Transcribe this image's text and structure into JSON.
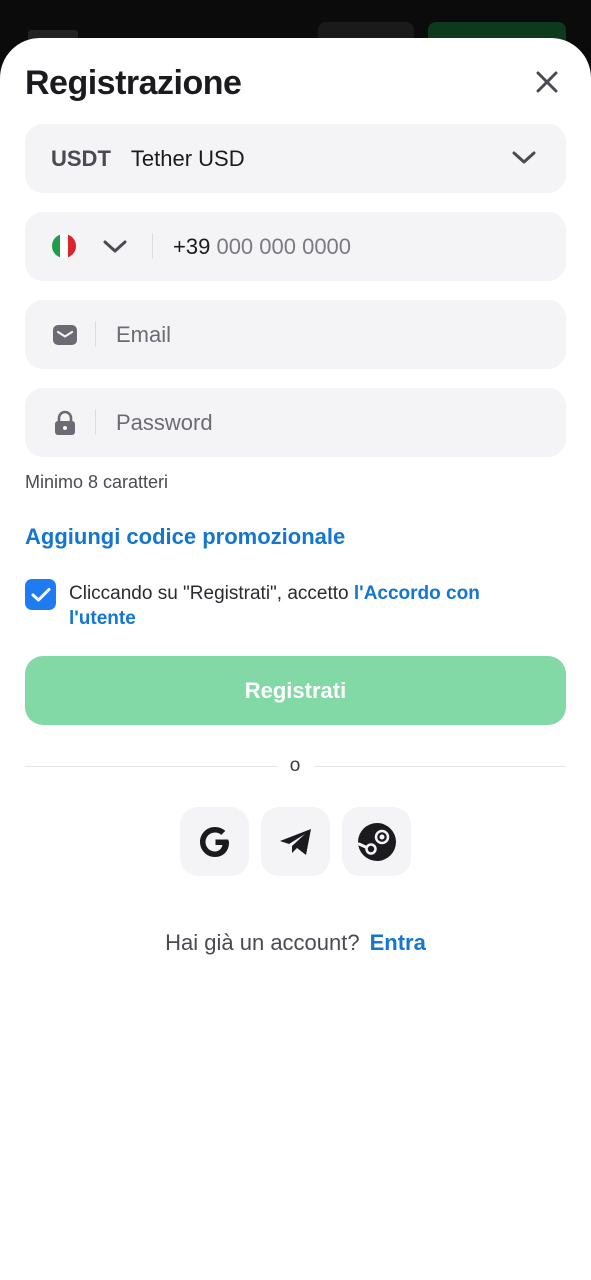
{
  "colors": {
    "accent": "#1576d2",
    "checkbox": "#1e7cf0",
    "submit_disabled": "#83d9a5",
    "field_bg": "#f4f4f6"
  },
  "modal": {
    "title": "Registrazione",
    "close_icon": "close-icon"
  },
  "currency": {
    "code": "USDT",
    "name": "Tether USD",
    "icon": "chevron-down-icon"
  },
  "phone": {
    "flag": "italy-flag-icon",
    "prefix": "+39",
    "placeholder": "000 000 0000"
  },
  "email": {
    "placeholder": "Email",
    "icon": "mail-icon"
  },
  "password": {
    "placeholder": "Password",
    "icon": "lock-icon",
    "hint": "Minimo 8 caratteri"
  },
  "promo_link": "Aggiungi codice promozionale",
  "agreement": {
    "checked": true,
    "text": "Cliccando su \"Registrati\", accetto ",
    "link": "l'Accordo con l'utente"
  },
  "submit_label": "Registrati",
  "divider_label": "o",
  "social": [
    "google-icon",
    "telegram-icon",
    "steam-icon"
  ],
  "login_prompt": {
    "text": "Hai già un account?",
    "link": "Entra"
  }
}
